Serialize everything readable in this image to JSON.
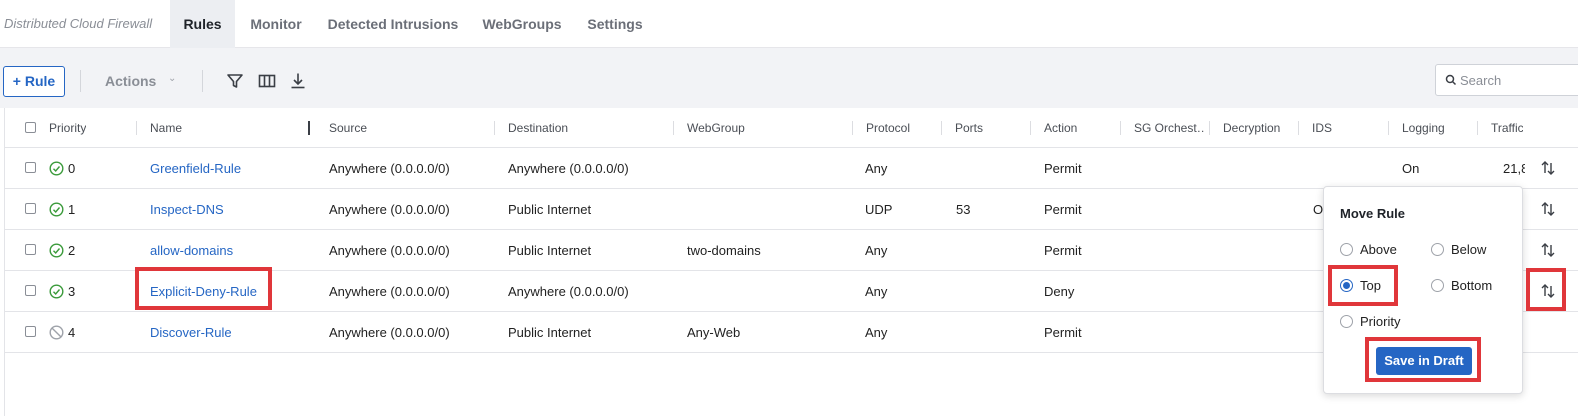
{
  "app": {
    "title": "Distributed Cloud Firewall"
  },
  "tabs": [
    {
      "label": "Rules",
      "active": true
    },
    {
      "label": "Monitor"
    },
    {
      "label": "Detected Intrusions"
    },
    {
      "label": "WebGroups"
    },
    {
      "label": "Settings"
    }
  ],
  "toolbar": {
    "add_rule_label": "+ Rule",
    "actions_label": "Actions",
    "search_placeholder": "Search",
    "icons": [
      "filter-icon",
      "columns-icon",
      "download-icon"
    ]
  },
  "table": {
    "columns": [
      "Priority",
      "Name",
      "Source",
      "Destination",
      "WebGroup",
      "Protocol",
      "Ports",
      "Action",
      "SG Orchest…",
      "Decryption",
      "IDS",
      "Logging",
      "Traffic"
    ],
    "rows": [
      {
        "priority": "0",
        "status": "enabled",
        "name": "Greenfield-Rule",
        "source": "Anywhere (0.0.0.0/0)",
        "destination": "Anywhere (0.0.0.0/0)",
        "webgroup": "",
        "protocol": "Any",
        "ports": "",
        "action": "Permit",
        "logging": "On",
        "traffic": "21,8"
      },
      {
        "priority": "1",
        "status": "enabled",
        "name": "Inspect-DNS",
        "source": "Anywhere (0.0.0.0/0)",
        "destination": "Public Internet",
        "webgroup": "",
        "protocol": "UDP",
        "ports": "53",
        "action": "Permit",
        "ids": "On"
      },
      {
        "priority": "2",
        "status": "enabled",
        "name": "allow-domains",
        "source": "Anywhere (0.0.0.0/0)",
        "destination": "Public Internet",
        "webgroup": "two-domains",
        "protocol": "Any",
        "ports": "",
        "action": "Permit"
      },
      {
        "priority": "3",
        "status": "enabled",
        "name": "Explicit-Deny-Rule",
        "source": "Anywhere (0.0.0.0/0)",
        "destination": "Anywhere (0.0.0.0/0)",
        "webgroup": "",
        "protocol": "Any",
        "ports": "",
        "action": "Deny"
      },
      {
        "priority": "4",
        "status": "disabled",
        "name": "Discover-Rule",
        "source": "Anywhere (0.0.0.0/0)",
        "destination": "Public Internet",
        "webgroup": "Any-Web",
        "protocol": "Any",
        "ports": "",
        "action": "Permit"
      }
    ]
  },
  "move_rule": {
    "title": "Move Rule",
    "options": [
      {
        "label": "Above",
        "selected": false
      },
      {
        "label": "Below",
        "selected": false
      },
      {
        "label": "Top",
        "selected": true
      },
      {
        "label": "Bottom",
        "selected": false
      },
      {
        "label": "Priority",
        "selected": false
      }
    ],
    "save_label": "Save in Draft"
  },
  "colors": {
    "accent": "#2566c4",
    "highlight": "#e0363a",
    "enabled_status": "#3a9a3a",
    "disabled_status": "#9ea2a9"
  }
}
